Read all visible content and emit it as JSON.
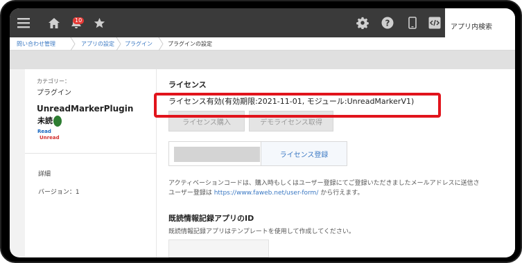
{
  "header": {
    "notification_count": "10",
    "search_tab_label": "アプリ内検索",
    "icons": [
      "menu-icon",
      "home-icon",
      "bell-icon",
      "star-icon",
      "gear-icon",
      "help-icon",
      "mobile-icon",
      "code-icon"
    ]
  },
  "breadcrumb": {
    "items": [
      "問い合わせ管理",
      "アプリの設定",
      "プラグイン",
      "プラグインの設定"
    ]
  },
  "sidebar": {
    "category_label": "カテゴリー：",
    "category_value": "プラグイン",
    "plugin_name": "UnreadMarkerPlugin",
    "logo_text_top": "未読",
    "logo_text_bottom": "Read Unread",
    "detail_link": "詳細",
    "version": "バージョン：1"
  },
  "license": {
    "title": "ライセンス",
    "status": "ライセンス有効(有効期限:2021-11-01, モジュール:UnreadMarkerV1)",
    "purchase_button": "ライセンス購入",
    "demo_button": "デモライセンス取得",
    "register_button": "ライセンス登録",
    "note_line1": "アクティベーションコードは、購入時もしくはユーザー登録にてご登録いただきましたメールアドレスに送信さ",
    "note_line2_prefix": "ユーザー登録は",
    "note_link": "https://www.faweb.net/user-form/",
    "note_line2_suffix": "から行えます。"
  },
  "read_log": {
    "title": "既読情報記録アプリのID",
    "description": "既読情報記録アプリはテンプレートを使用して作成してください。"
  },
  "colors": {
    "header_bg": "#3a3a3a",
    "link": "#3a78c3",
    "highlight": "#e1141c",
    "badge": "#e53935"
  }
}
